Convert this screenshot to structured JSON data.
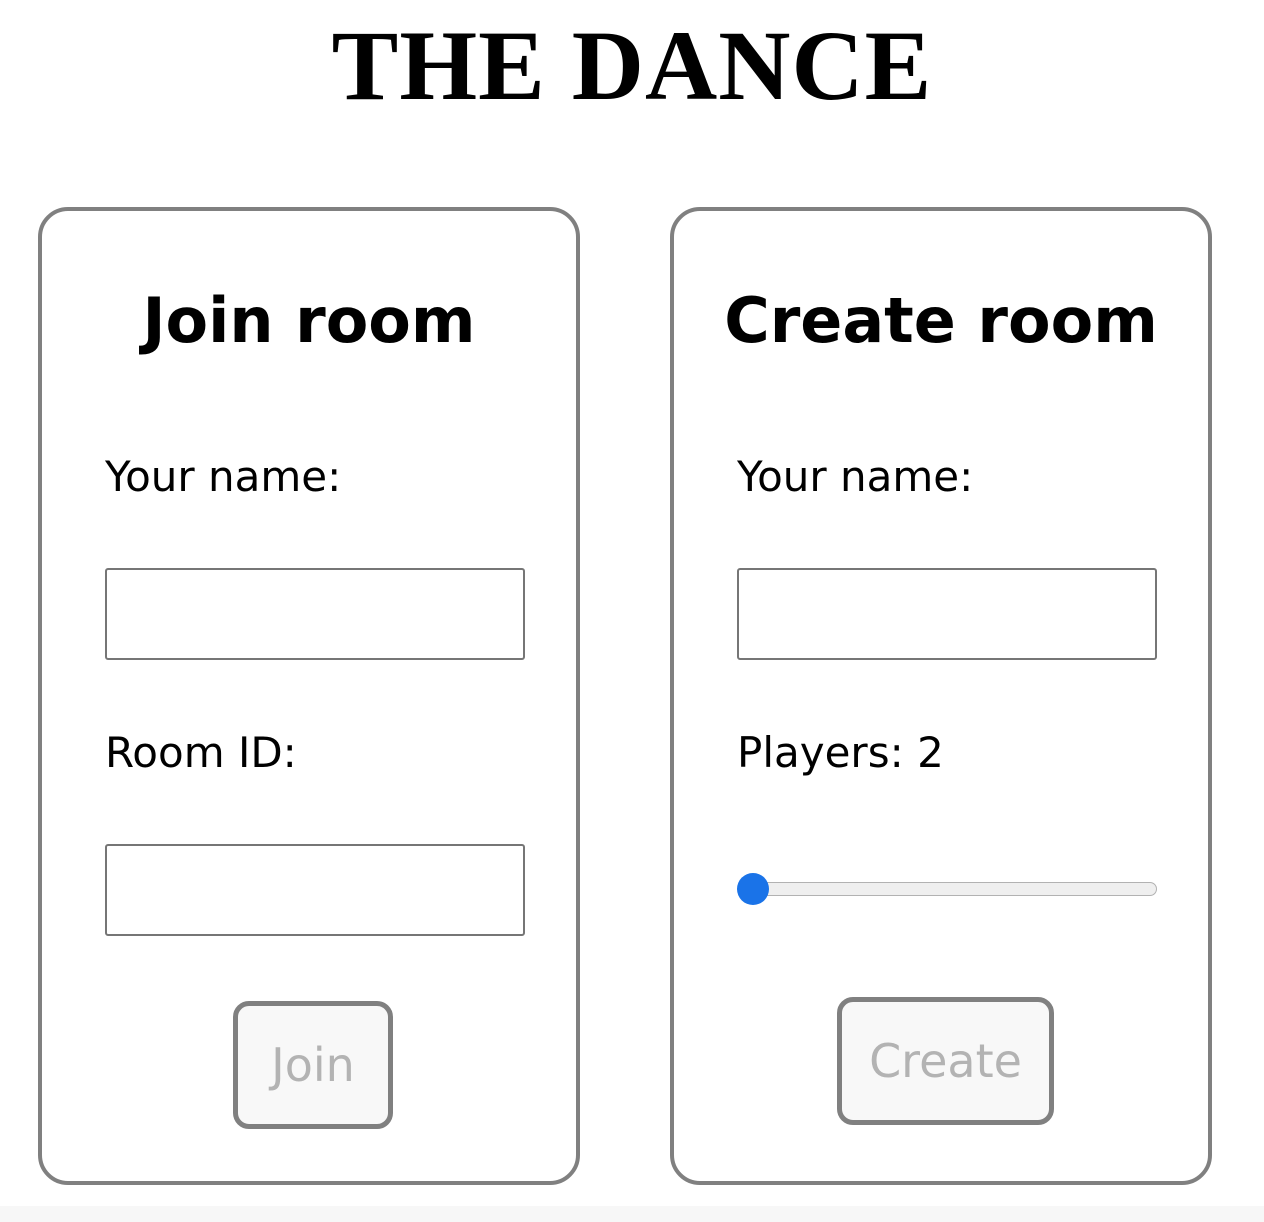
{
  "app": {
    "title": "THE DANCE"
  },
  "join_card": {
    "title": "Join room",
    "name_label": "Your name:",
    "name_value": "",
    "room_id_label": "Room ID:",
    "room_id_value": "",
    "join_button": "Join"
  },
  "create_card": {
    "title": "Create room",
    "name_label": "Your name:",
    "name_value": "",
    "players_label": "Players: 2",
    "players_value": 2,
    "create_button": "Create"
  },
  "colors": {
    "accent": "#1a73e8",
    "border": "#808080",
    "disabled_text": "#b3b3b3"
  }
}
